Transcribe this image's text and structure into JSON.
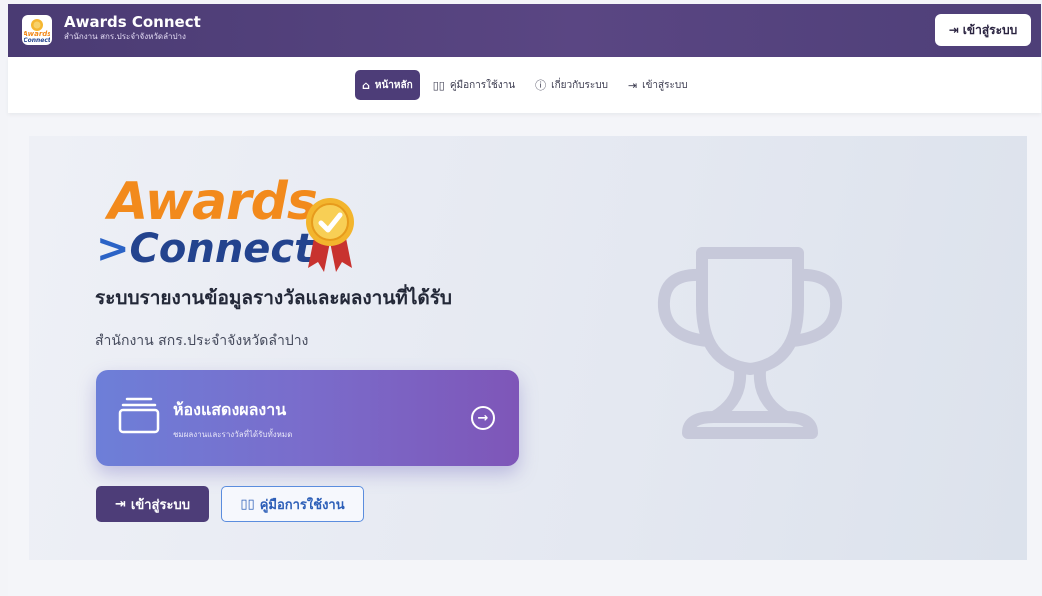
{
  "header": {
    "title": "Awards Connect",
    "subtitle": "สำนักงาน สกร.ประจำจังหวัดลำปาง",
    "login_button": "เข้าสู่ระบบ",
    "logo_text": "Awards Connect"
  },
  "nav": {
    "items": [
      {
        "label": "หน้าหลัก",
        "icon": "home-icon",
        "active": true
      },
      {
        "label": "คู่มือการใช้งาน",
        "icon": "book-icon",
        "active": false
      },
      {
        "label": "เกี่ยวกับระบบ",
        "icon": "info-icon",
        "active": false
      },
      {
        "label": "เข้าสู่ระบบ",
        "icon": "login-icon",
        "active": false
      }
    ]
  },
  "hero": {
    "logo_awards": "Awards",
    "logo_connect": "Connect",
    "title": "ระบบรายงานข้อมูลรางวัลและผลงานที่ได้รับ",
    "subtitle": "สำนักงาน สกร.ประจำจังหวัดลำปาง",
    "card_title": "ห้องแสดงผลงาน",
    "card_subtitle": "ชมผลงานและรางวัลที่ได้รับทั้งหมด",
    "login_button": "เข้าสู่ระบบ",
    "manual_button": "คู่มือการใช้งาน"
  },
  "colors": {
    "header_bg": "#4a3b73",
    "primary": "#4d3d78",
    "accent_orange": "#f28a1c",
    "accent_blue": "#23438e",
    "card_gradient_start": "#6d7fd8",
    "card_gradient_end": "#7e56b8"
  }
}
